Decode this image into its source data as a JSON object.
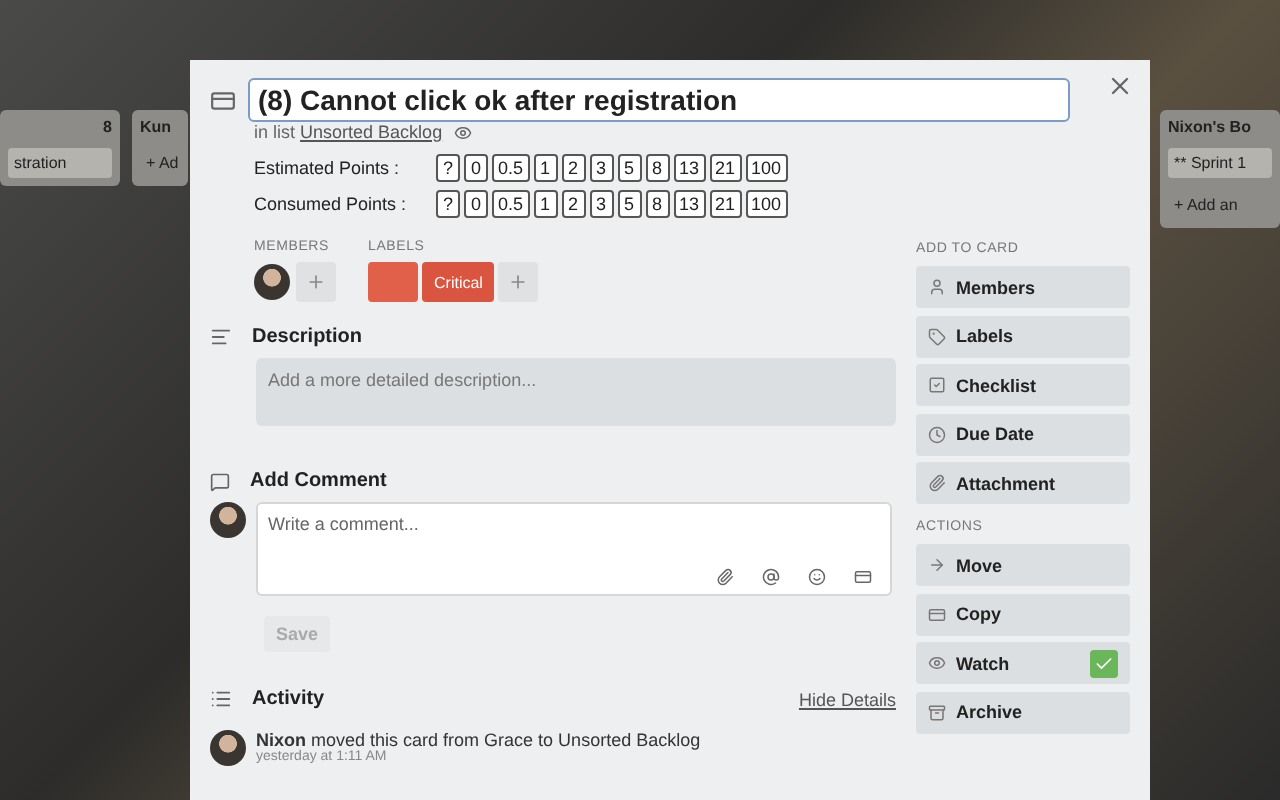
{
  "board": {
    "lists": [
      {
        "title": "8",
        "cards": [
          "stration"
        ]
      },
      {
        "title": "Kun",
        "cards": [
          "+ Ad"
        ]
      },
      {
        "title": "Nixon's Bo",
        "cards": [
          "** Sprint 1",
          "+ Add an"
        ]
      }
    ]
  },
  "card": {
    "title": "(8) Cannot click ok after registration",
    "list_prefix": "in list",
    "list_name": "Unsorted Backlog",
    "point_rows": [
      {
        "label": "Estimated Points :",
        "values": [
          "?",
          "0",
          "0.5",
          "1",
          "2",
          "3",
          "5",
          "8",
          "13",
          "21",
          "100"
        ]
      },
      {
        "label": "Consumed Points :",
        "values": [
          "?",
          "0",
          "0.5",
          "1",
          "2",
          "3",
          "5",
          "8",
          "13",
          "21",
          "100"
        ]
      }
    ],
    "members_heading": "MEMBERS",
    "labels_heading": "LABELS",
    "labels": [
      {
        "color": "#e0604a"
      },
      {
        "text": "Critical",
        "color": "#d9553f"
      }
    ],
    "description": {
      "heading": "Description",
      "placeholder": "Add a more detailed description..."
    },
    "comment": {
      "heading": "Add Comment",
      "placeholder": "Write a comment...",
      "save": "Save"
    },
    "activity": {
      "heading": "Activity",
      "toggle": "Hide Details",
      "entries": [
        {
          "text": "**Nixon** moved this card from Grace to Unsorted Backlog",
          "time": "yesterday at 1:11 AM"
        }
      ]
    }
  },
  "sidebar": {
    "groups": [
      {
        "heading": "ADD TO CARD",
        "buttons": [
          {
            "label": "Members",
            "checked": false
          },
          {
            "label": "Labels",
            "checked": false
          },
          {
            "label": "Checklist",
            "checked": false
          },
          {
            "label": "Due Date",
            "checked": false
          },
          {
            "label": "Attachment",
            "checked": false
          }
        ]
      },
      {
        "heading": "ACTIONS",
        "buttons": [
          {
            "label": "Move",
            "checked": false
          },
          {
            "label": "Copy",
            "checked": false
          },
          {
            "label": "Watch",
            "checked": true
          },
          {
            "label": "Archive",
            "checked": false
          }
        ]
      }
    ]
  }
}
